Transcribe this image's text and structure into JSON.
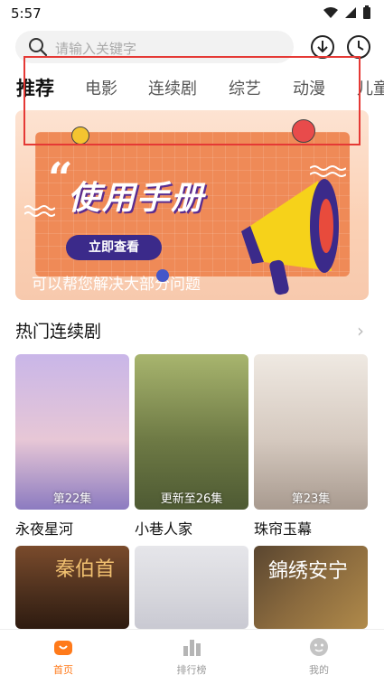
{
  "status": {
    "time": "5:57"
  },
  "search": {
    "placeholder": "请输入关键字"
  },
  "tabs": [
    {
      "label": "推荐",
      "active": true
    },
    {
      "label": "电影"
    },
    {
      "label": "连续剧"
    },
    {
      "label": "综艺"
    },
    {
      "label": "动漫"
    },
    {
      "label": "儿童"
    }
  ],
  "banner": {
    "quote_mark": "“",
    "title": "使用手册",
    "button": "立即查看",
    "caption": "可以帮您解决大部分问题"
  },
  "section": {
    "title": "热门连续剧",
    "arrow": "›"
  },
  "shows": [
    {
      "title": "永夜星河",
      "badge": "第22集",
      "colors": [
        "#c9b6e8",
        "#8c7bc0"
      ]
    },
    {
      "title": "小巷人家",
      "badge": "更新至26集",
      "colors": [
        "#8a9a5b",
        "#4e5a33"
      ]
    },
    {
      "title": "珠帘玉幕",
      "badge": "第23集",
      "colors": [
        "#e8e0d8",
        "#a89a8f"
      ]
    },
    {
      "title": "",
      "badge": "",
      "colors": [
        "#7a4b2c",
        "#2e1b10"
      ]
    },
    {
      "title": "",
      "badge": "",
      "colors": [
        "#e6e6ea",
        "#c9c9d2"
      ]
    },
    {
      "title": "",
      "badge": "",
      "colors": [
        "#5a4630",
        "#b08a4a"
      ]
    }
  ],
  "row2_posters": [
    "秦伯首",
    "",
    "錦绣安宁"
  ],
  "nav": [
    {
      "label": "首页",
      "active": true,
      "icon": "home-icon"
    },
    {
      "label": "排行榜",
      "active": false,
      "icon": "ranking-icon"
    },
    {
      "label": "我的",
      "active": false,
      "icon": "profile-icon"
    }
  ],
  "colors": {
    "accent": "#ff7a1a",
    "highlight": "#e53935",
    "inactive": "#b5b5b5"
  }
}
